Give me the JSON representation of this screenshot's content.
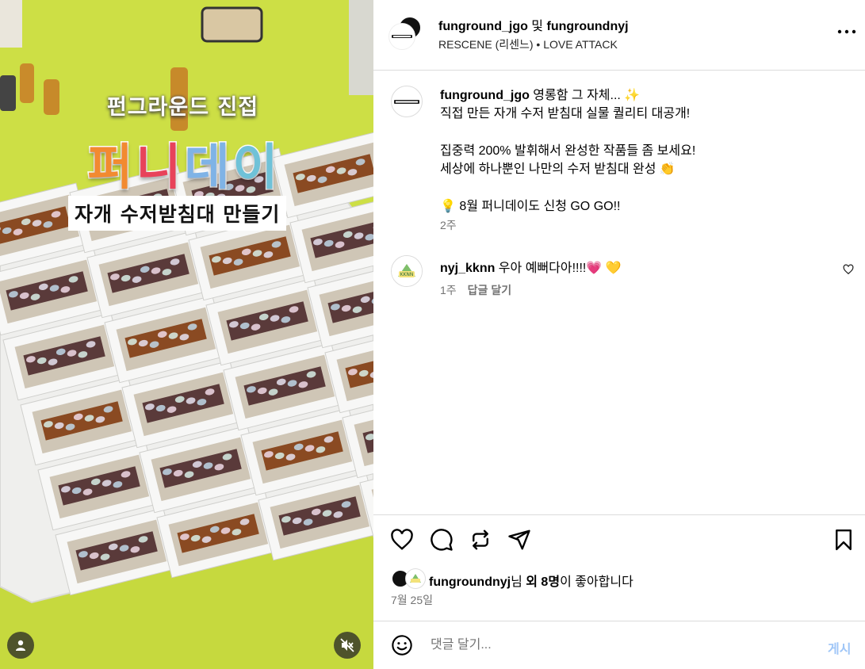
{
  "media": {
    "overlay_line1": "펀그라운드 진접",
    "overlay_line2": [
      "퍼",
      "니",
      "데",
      "이"
    ],
    "overlay_line3": "자개 수저받침대 만들기",
    "user_tag_icon": "user-icon",
    "mute_icon": "speaker-muted-icon"
  },
  "header": {
    "account1": "funground_jgo",
    "and": " 및 ",
    "account2": "fungroundnyj",
    "audio": "RESCENE (리센느) • LOVE ATTACK",
    "more_icon": "more-dots-icon"
  },
  "caption": {
    "username": "funground_jgo",
    "text": " 영롱함 그 자체... ✨\n직접 만든 자개 수저 받침대 실물 퀄리티 대공개!\n\n집중력 200% 발휘해서 완성한 작품들 좀 보세요!\n세상에 하나뿐인 나만의 수저 받침대 완성 👏\n\n💡 8월 퍼니데이도 신청 GO GO!!",
    "time": "2주"
  },
  "comments": [
    {
      "username": "nyj_kknn",
      "text": " 우아 예뻐다아!!!!💗 💛",
      "time": "1주",
      "reply": "답글 달기"
    }
  ],
  "actions": {
    "icons": [
      "heart-icon",
      "comment-icon",
      "repost-icon",
      "share-icon",
      "bookmark-icon"
    ]
  },
  "likes": {
    "user": "fungroundnyj",
    "mid": "님 ",
    "others": "외 8명",
    "tail": "이 좋아합니다"
  },
  "date": "7월 25일",
  "comment_box": {
    "placeholder": "댓글 달기...",
    "post_label": "게시"
  },
  "colors": {
    "table": "#cfe146",
    "link_disabled": "#9fc6f7",
    "muted_text": "#737373"
  }
}
